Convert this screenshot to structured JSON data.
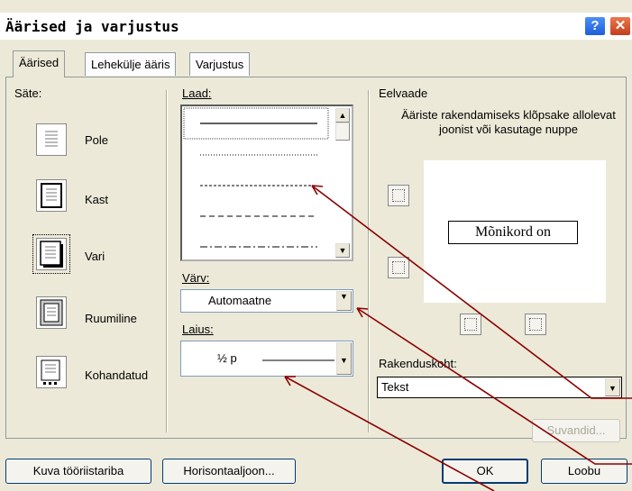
{
  "window": {
    "title": "Äärised ja varjustus",
    "help_glyph": "?",
    "close_glyph": "✕"
  },
  "tabs": [
    {
      "label": "Äärised",
      "active": true
    },
    {
      "label": "Lehekülje ääris",
      "active": false
    },
    {
      "label": "Varjustus",
      "active": false
    }
  ],
  "setting": {
    "label": "Säte:",
    "options": [
      {
        "label": "Pole",
        "icon": "border-none-icon"
      },
      {
        "label": "Kast",
        "icon": "border-box-icon"
      },
      {
        "label": "Vari",
        "icon": "border-shadow-icon",
        "selected": true
      },
      {
        "label": "Ruumiline",
        "icon": "border-3d-icon"
      },
      {
        "label": "Kohandatud",
        "icon": "border-custom-icon"
      }
    ]
  },
  "style": {
    "label": "Laad:"
  },
  "color": {
    "label": "Värv:",
    "value": "Automaatne"
  },
  "width": {
    "label": "Laius:",
    "value": "½ p"
  },
  "preview": {
    "label": "Eelvaade",
    "hint": "Ääriste rakendamiseks klõpsake allolevat joonist või kasutage nuppe",
    "sample_text": "Mõnikord on"
  },
  "apply_to": {
    "label": "Rakenduskoht:",
    "value": "Tekst"
  },
  "buttons": {
    "options": "Suvandid...",
    "toolbar": "Kuva tööriistariba",
    "horizontal_line": "Horisontaaljoon...",
    "ok": "OK",
    "cancel": "Loobu"
  },
  "colors": {
    "dialog_bg": "#ece9d8",
    "annotation_arrow": "#8b0000"
  }
}
